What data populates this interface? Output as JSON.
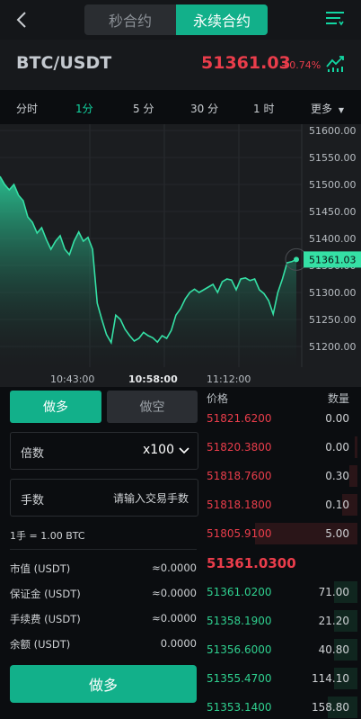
{
  "header": {
    "tabs": [
      "秒合约",
      "永续合约"
    ],
    "active_tab": "永续合约"
  },
  "ticker": {
    "pair": "BTC/USDT",
    "price": "51361.03",
    "change": "+0.74%"
  },
  "intervals": {
    "items": [
      "分时",
      "1分",
      "5 分",
      "30 分",
      "1 时"
    ],
    "active": "1分",
    "more": "更多"
  },
  "chart_data": {
    "type": "area",
    "y_ticks": [
      "51600.00",
      "51550.00",
      "51500.00",
      "51450.00",
      "51400.00",
      "51350.00",
      "51300.00",
      "51250.00",
      "51200.00"
    ],
    "ylim": [
      51175,
      51610
    ],
    "x_ticks": [
      "10:43:00",
      "10:58:00",
      "11:12:00"
    ],
    "current_label": "51361.03",
    "values": [
      51515,
      51500,
      51490,
      51500,
      51480,
      51470,
      51440,
      51430,
      51410,
      51420,
      51398,
      51380,
      51395,
      51405,
      51380,
      51370,
      51395,
      51412,
      51395,
      51402,
      51380,
      51280,
      51250,
      51222,
      51207,
      51258,
      51250,
      51232,
      51220,
      51210,
      51215,
      51226,
      51220,
      51216,
      51208,
      51220,
      51215,
      51230,
      51258,
      51270,
      51288,
      51300,
      51306,
      51300,
      51305,
      51310,
      51315,
      51300,
      51320,
      51325,
      51323,
      51305,
      51325,
      51327,
      51322,
      51325,
      51305,
      51298,
      51285,
      51260,
      51300,
      51325,
      51355,
      51357,
      51361
    ]
  },
  "trade": {
    "long_label": "做多",
    "short_label": "做空",
    "multiplier_label": "倍数",
    "multiplier_value": "x100",
    "lots_label": "手数",
    "lots_placeholder": "请输入交易手数",
    "lot_unit": "1手 = 1.00 BTC",
    "info": [
      {
        "k": "市值 (USDT)",
        "v": "≈0.0000"
      },
      {
        "k": "保证金 (USDT)",
        "v": "≈0.0000"
      },
      {
        "k": "手续费 (USDT)",
        "v": "≈0.0000"
      },
      {
        "k": "余额 (USDT)",
        "v": "0.0000"
      }
    ],
    "submit_label": "做多"
  },
  "orderbook": {
    "price_header": "价格",
    "qty_header": "数量",
    "asks": [
      {
        "p": "51821.6200",
        "q": "0.00",
        "depth": 0.0
      },
      {
        "p": "51820.3800",
        "q": "0.00",
        "depth": 0.02
      },
      {
        "p": "51818.7600",
        "q": "0.30",
        "depth": 0.05
      },
      {
        "p": "51818.1800",
        "q": "0.10",
        "depth": 0.1
      },
      {
        "p": "51805.9100",
        "q": "5.00",
        "depth": 0.66
      }
    ],
    "mid": "51361.0300",
    "bids": [
      {
        "p": "51361.0200",
        "q": "71.00",
        "depth": 0.15
      },
      {
        "p": "51358.1900",
        "q": "21.20",
        "depth": 0.15
      },
      {
        "p": "51356.6000",
        "q": "40.80",
        "depth": 0.15
      },
      {
        "p": "51355.4700",
        "q": "114.10",
        "depth": 0.15
      },
      {
        "p": "51353.1400",
        "q": "158.80",
        "depth": 0.19
      }
    ]
  },
  "colors": {
    "accent": "#12b08a",
    "up": "#2fd08f",
    "down": "#ea3d4b",
    "chart_line": "#35e0a5"
  }
}
